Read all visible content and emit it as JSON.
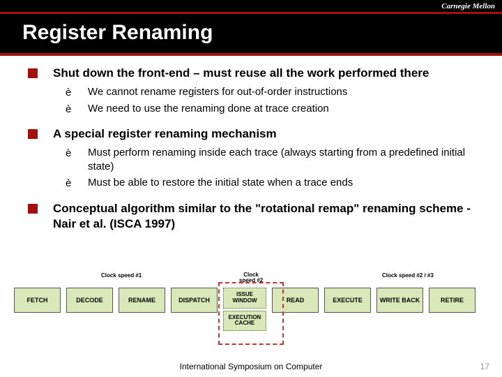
{
  "header": {
    "org": "Carnegie Mellon",
    "title": "Register Renaming"
  },
  "bullets": [
    {
      "text": "Shut down the front-end – must reuse all the work performed there",
      "subs": [
        "We cannot rename registers for out-of-order instructions",
        "We need to use the renaming done at trace creation"
      ]
    },
    {
      "text": "A special register renaming mechanism",
      "subs": [
        "Must perform renaming inside each trace (always starting from a predefined initial state)",
        "Must be able to restore the initial state when a trace ends"
      ]
    },
    {
      "text": "Conceptual algorithm similar to the \"rotational remap\" renaming scheme - Nair et al. (ISCA 1997)",
      "subs": []
    }
  ],
  "pipeline": {
    "clock1": "Clock speed #1",
    "clock2_a": "Clock",
    "clock2_b": "speed #2",
    "clock3": "Clock speed #2 / #3",
    "stages": {
      "fetch": "FETCH",
      "decode": "DECODE",
      "rename": "RENAME",
      "dispatch": "DISPATCH",
      "issue": "ISSUE WINDOW",
      "execcache": "EXECUTION CACHE",
      "read": "READ",
      "execute": "EXECUTE",
      "writeback": "WRITE BACK",
      "retire": "RETIRE"
    }
  },
  "footer": {
    "venue": "International Symposium on Computer",
    "page": "17"
  }
}
